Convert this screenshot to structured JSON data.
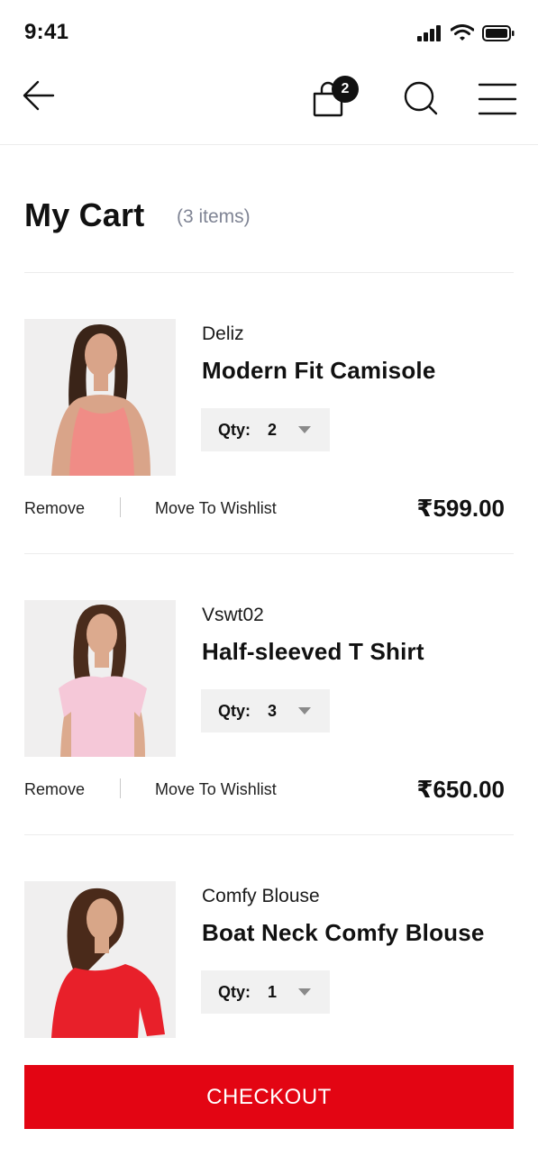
{
  "status": {
    "time": "9:41"
  },
  "nav": {
    "bag_count": "2"
  },
  "cart": {
    "title": "My Cart",
    "count_label": "(3 items)"
  },
  "items": [
    {
      "brand": "Deliz",
      "name": "Modern Fit Camisole",
      "qty_label": "Qty:",
      "qty": "2",
      "remove": "Remove",
      "wishlist": "Move To Wishlist",
      "price": "₹599.00",
      "garment_color": "#f08c86"
    },
    {
      "brand": "Vswt02",
      "name": "Half-sleeved T Shirt",
      "qty_label": "Qty:",
      "qty": "3",
      "remove": "Remove",
      "wishlist": "Move To Wishlist",
      "price": "₹650.00",
      "garment_color": "#f5c8d8"
    },
    {
      "brand": "Comfy Blouse",
      "name": "Boat Neck Comfy Blouse",
      "qty_label": "Qty:",
      "qty": "1",
      "garment_color": "#e8202a"
    }
  ],
  "checkout_label": "CHECKOUT",
  "colors": {
    "accent": "#e30513",
    "muted_text": "#7f8494"
  }
}
